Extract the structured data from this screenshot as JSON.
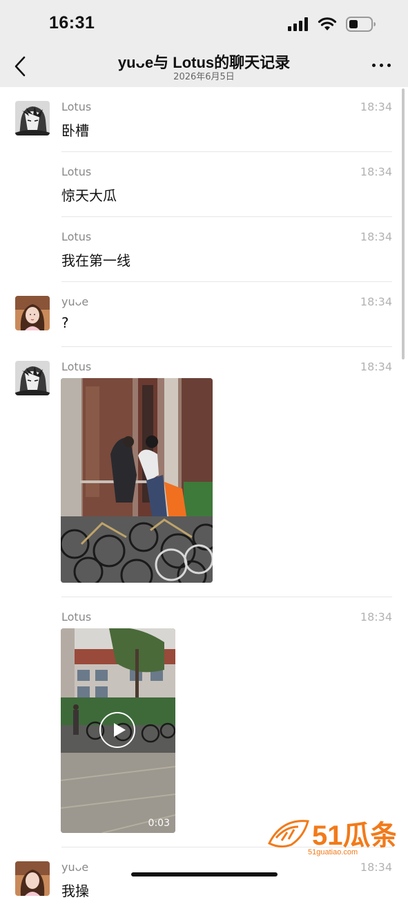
{
  "status_bar": {
    "time": "16:31"
  },
  "nav": {
    "title": "yuᴗe与 Lotus的聊天记录",
    "subtitle": "2026年6月5日"
  },
  "messages": [
    {
      "sender": "Lotus",
      "time": "18:34",
      "text": "卧槽",
      "avatar": "avatar-lotus"
    },
    {
      "sender": "Lotus",
      "time": "18:34",
      "text": "惊天大瓜"
    },
    {
      "sender": "Lotus",
      "time": "18:34",
      "text": "我在第一线"
    },
    {
      "sender": "yuᴗe",
      "time": "18:34",
      "text": "?",
      "avatar": "avatar-yue"
    },
    {
      "sender": "Lotus",
      "time": "18:34",
      "type": "image",
      "avatar": "avatar-lotus"
    },
    {
      "sender": "Lotus",
      "time": "18:34",
      "type": "video",
      "duration": "0:03"
    },
    {
      "sender": "yuᴗe",
      "time": "18:34",
      "text": "我操",
      "avatar": "avatar-yue"
    }
  ],
  "watermark": {
    "brand": "51瓜条",
    "url": "51guatiao.com",
    "color": "#f27a1a"
  }
}
